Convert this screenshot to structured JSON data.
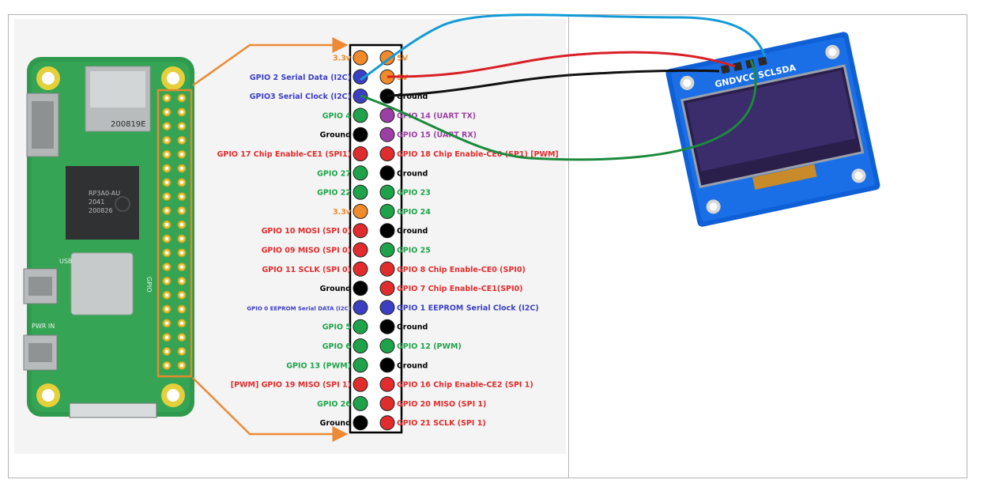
{
  "colors": {
    "orange": "#f08a2a",
    "blue": "#3b3fc4",
    "black": "#000000",
    "green": "#1fa34a",
    "purple": "#9b3fa5",
    "red": "#e02c2c",
    "wire_cyan": "#139bd6",
    "wire_red": "#d81f26",
    "wire_black": "#111111",
    "wire_green": "#1c8a3c"
  },
  "pins": [
    {
      "left": "3.3v",
      "left_color": "orange",
      "right": "5V",
      "right_color": "orange"
    },
    {
      "left": "GPIO 2 Serial Data (I2C)",
      "left_color": "blue",
      "right": "5V",
      "right_color": "orange"
    },
    {
      "left": "GPIO3 Serial Clock (I2C)",
      "left_color": "blue",
      "right": "Ground",
      "right_color": "black"
    },
    {
      "left": "GPIO 4",
      "left_color": "green",
      "right": "GPIO 14 (UART TX)",
      "right_color": "purple"
    },
    {
      "left": "Ground",
      "left_color": "black",
      "right": "GPIO 15 (UART RX)",
      "right_color": "purple"
    },
    {
      "left": "GPIO 17 Chip Enable-CE1 (SPI1)",
      "left_color": "red",
      "right": "GPIO 18 Chip Enable-CE0 (SP1) [PWM]",
      "right_color": "red"
    },
    {
      "left": "GPIO 27",
      "left_color": "green",
      "right": "Ground",
      "right_color": "black"
    },
    {
      "left": "GPIO 22",
      "left_color": "green",
      "right": "GPIO 23",
      "right_color": "green"
    },
    {
      "left": "3.3v",
      "left_color": "orange",
      "right": "GPIO 24",
      "right_color": "green"
    },
    {
      "left": "GPIO 10 MOSI (SPI 0)",
      "left_color": "red",
      "right": "Ground",
      "right_color": "black"
    },
    {
      "left": "GPIO 09 MISO (SPI 0)",
      "left_color": "red",
      "right": "GPIO 25",
      "right_color": "green"
    },
    {
      "left": "GPIO 11 SCLK (SPI 0)",
      "left_color": "red",
      "right": "GPIO 8 Chip Enable-CE0 (SPI0)",
      "right_color": "red"
    },
    {
      "left": "Ground",
      "left_color": "black",
      "right": "GPIO 7 Chip Enable-CE1(SPI0)",
      "right_color": "red"
    },
    {
      "left": "GPIO 0 EEPROM Serial DATA (I2C)",
      "left_color": "blue",
      "right": "GPIO 1 EEPROM Serial Clock (I2C)",
      "right_color": "blue",
      "left_small": true
    },
    {
      "left": "GPIO 5",
      "left_color": "green",
      "right": "Ground",
      "right_color": "black"
    },
    {
      "left": "GPIO 6",
      "left_color": "green",
      "right": "GPIO 12 (PWM)",
      "right_color": "green"
    },
    {
      "left": "GPIO 13 (PWM)",
      "left_color": "green",
      "right": "Ground",
      "right_color": "black"
    },
    {
      "left": "[PWM] GPIO 19 MISO (SPI 1)",
      "left_color": "red",
      "right": "GPIO 16 Chip Enable-CE2 (SPI 1)",
      "right_color": "red"
    },
    {
      "left": "GPIO 26",
      "left_color": "green",
      "right": "GPIO 20 MISO (SPI 1)",
      "right_color": "red"
    },
    {
      "left": "Ground",
      "left_color": "black",
      "right": "GPIO 21 SCLK (SPI 1)",
      "right_color": "red"
    }
  ],
  "board": {
    "chip_lines": [
      "RP3A0-AU",
      "2041",
      "200826"
    ],
    "sd_text": "200819E",
    "usb_label": "USB",
    "pwr_label": "PWR IN",
    "gpio_label": "GPIO"
  },
  "oled": {
    "pin_labels": "GNDVCC SCLSDA"
  }
}
